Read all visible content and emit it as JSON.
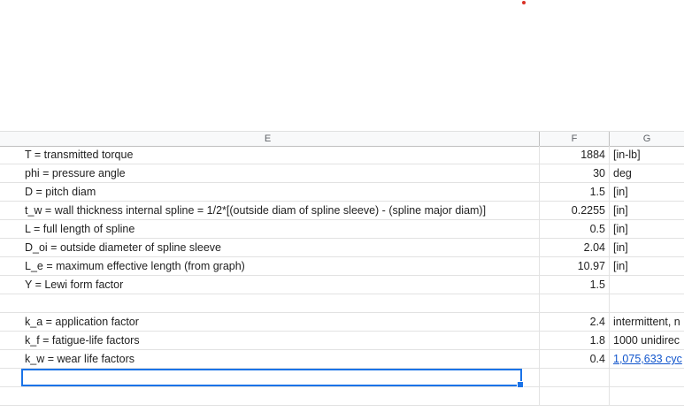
{
  "columns": {
    "E": "E",
    "F": "F",
    "G": "G"
  },
  "rows": [
    {
      "e": "T = transmitted torque",
      "f": "1884",
      "g": "[in-lb]"
    },
    {
      "e": "phi = pressure angle",
      "f": "30",
      "g": "deg"
    },
    {
      "e": "D = pitch diam",
      "f": "1.5",
      "g": "[in]"
    },
    {
      "e": "t_w = wall thickness internal spline = 1/2*[(outside diam of spline sleeve) - (spline major diam)]",
      "f": "0.2255",
      "g": "[in]"
    },
    {
      "e": "L = full length of spline",
      "f": "0.5",
      "g": "[in]"
    },
    {
      "e": "D_oi = outside diameter of spline sleeve",
      "f": "2.04",
      "g": "[in]"
    },
    {
      "e": "L_e = maximum effective length (from graph)",
      "f": "10.97",
      "g": "[in]"
    },
    {
      "e": "Y = Lewi form factor",
      "f": "1.5",
      "g": ""
    },
    {
      "e": "",
      "f": "",
      "g": ""
    },
    {
      "e": "k_a = application factor",
      "f": "2.4",
      "g": "intermittent, n"
    },
    {
      "e": "k_f = fatigue-life factors",
      "f": "1.8",
      "g": "1000 unidirec"
    },
    {
      "e": "k_w = wear life factors",
      "f": "0.4",
      "g": "1,075,633 cyc"
    },
    {
      "e": "",
      "f": "",
      "g": ""
    },
    {
      "e": "",
      "f": "",
      "g": ""
    }
  ]
}
